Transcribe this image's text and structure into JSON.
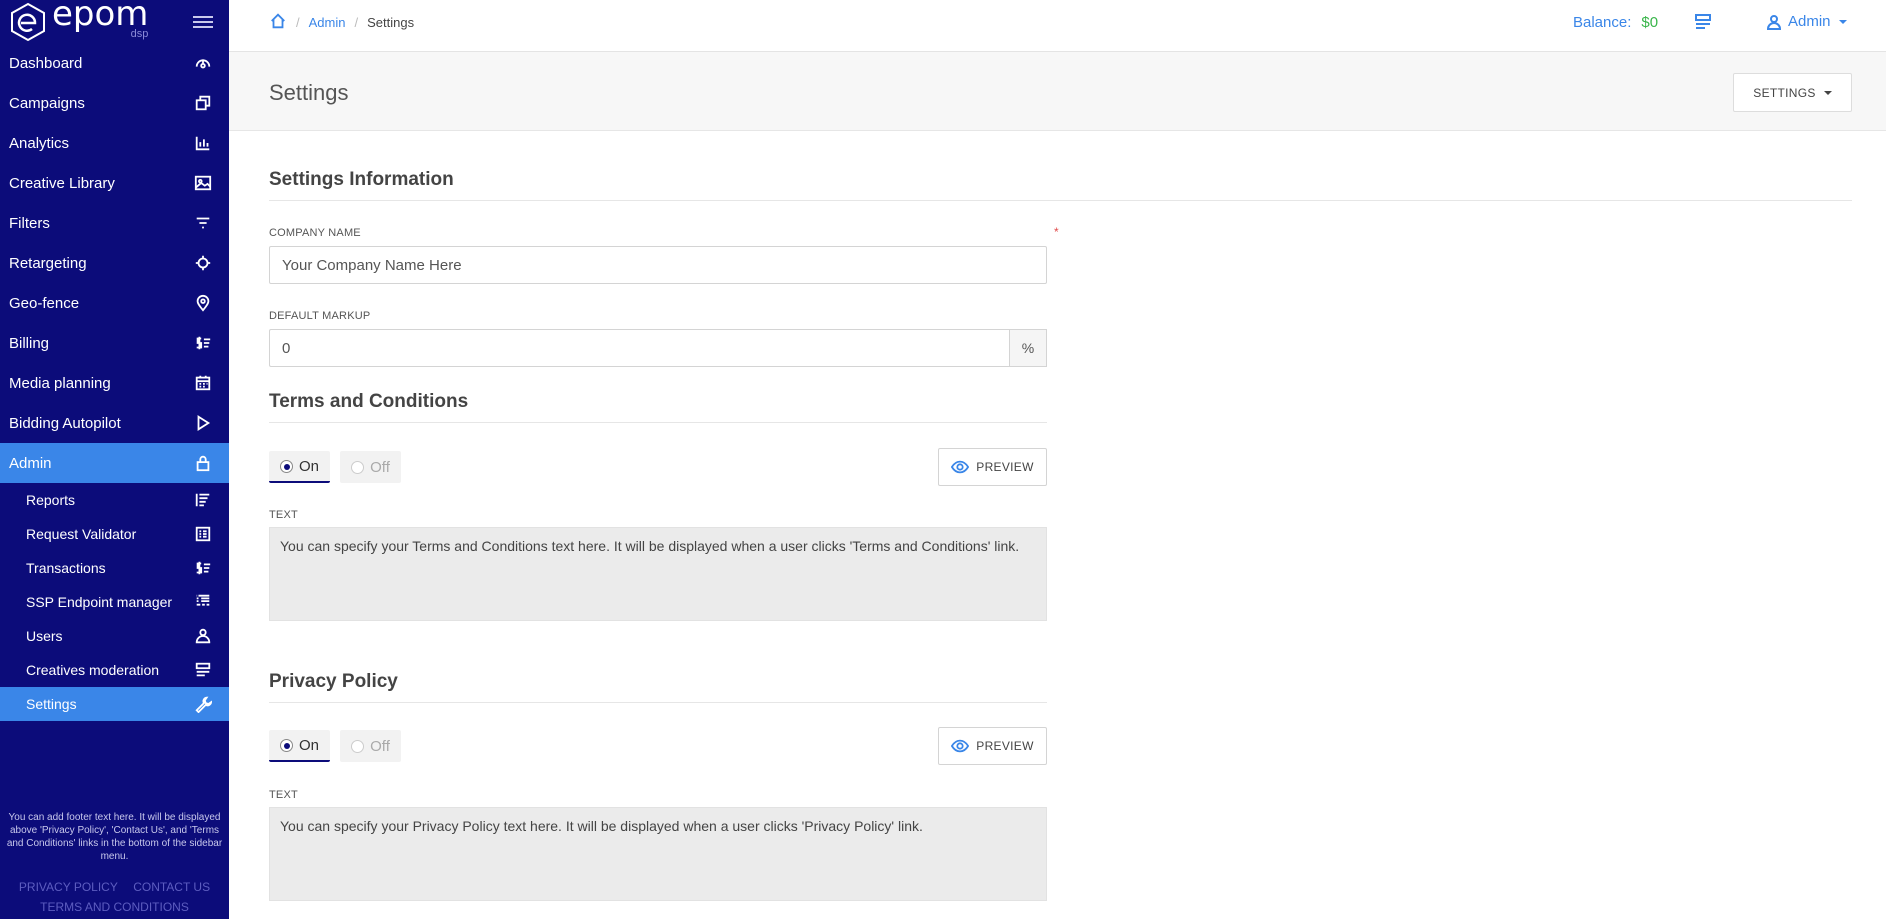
{
  "brand": {
    "name": "epom",
    "sub": "dsp"
  },
  "sidebar": {
    "items": [
      {
        "label": "Dashboard",
        "icon": "dashboard-icon"
      },
      {
        "label": "Campaigns",
        "icon": "campaigns-icon"
      },
      {
        "label": "Analytics",
        "icon": "analytics-icon"
      },
      {
        "label": "Creative Library",
        "icon": "image-icon"
      },
      {
        "label": "Filters",
        "icon": "filter-icon"
      },
      {
        "label": "Retargeting",
        "icon": "crosshair-icon"
      },
      {
        "label": "Geo-fence",
        "icon": "location-pin-icon"
      },
      {
        "label": "Billing",
        "icon": "billing-icon"
      },
      {
        "label": "Media planning",
        "icon": "calendar-icon"
      },
      {
        "label": "Bidding Autopilot",
        "icon": "play-icon"
      },
      {
        "label": "Admin",
        "icon": "lock-icon"
      }
    ],
    "admin_sub": [
      {
        "label": "Reports",
        "icon": "reports-icon"
      },
      {
        "label": "Request Validator",
        "icon": "list-box-icon"
      },
      {
        "label": "Transactions",
        "icon": "transactions-icon"
      },
      {
        "label": "SSP Endpoint manager",
        "icon": "ssp-icon"
      },
      {
        "label": "Users",
        "icon": "users-icon"
      },
      {
        "label": "Creatives moderation",
        "icon": "moderation-icon"
      },
      {
        "label": "Settings",
        "icon": "wrench-icon"
      }
    ],
    "footer_text": "You can add footer text here. It will be displayed above 'Privacy Policy', 'Contact Us', and 'Terms and Conditions' links in the bottom of the sidebar menu.",
    "footer_links": {
      "privacy": "PRIVACY POLICY",
      "contact": "CONTACT US",
      "terms": "TERMS AND CONDITIONS"
    }
  },
  "topbar": {
    "breadcrumb": {
      "admin": "Admin",
      "current": "Settings"
    },
    "balance_label": "Balance:",
    "balance_value": "$0",
    "user": "Admin"
  },
  "header": {
    "title": "Settings",
    "settings_button": "SETTINGS"
  },
  "settings_info": {
    "title": "Settings Information",
    "company_label": "COMPANY NAME",
    "company_required": "*",
    "company_value": "Your Company Name Here",
    "markup_label": "DEFAULT MARKUP",
    "markup_value": "0",
    "markup_unit": "%"
  },
  "terms": {
    "title": "Terms and Conditions",
    "on_label": "On",
    "off_label": "Off",
    "preview_label": "PREVIEW",
    "text_label": "TEXT",
    "text": "You can specify your Terms and Conditions text here. It will be displayed when a user clicks 'Terms and Conditions' link."
  },
  "privacy": {
    "title": "Privacy Policy",
    "on_label": "On",
    "off_label": "Off",
    "preview_label": "PREVIEW",
    "text_label": "TEXT",
    "text": "You can specify your Privacy Policy text here. It will be displayed when a user clicks 'Privacy Policy' link."
  },
  "colors": {
    "sidebar_bg": "#0c0c7a",
    "accent": "#3a86e8",
    "balance": "#39b54a"
  }
}
